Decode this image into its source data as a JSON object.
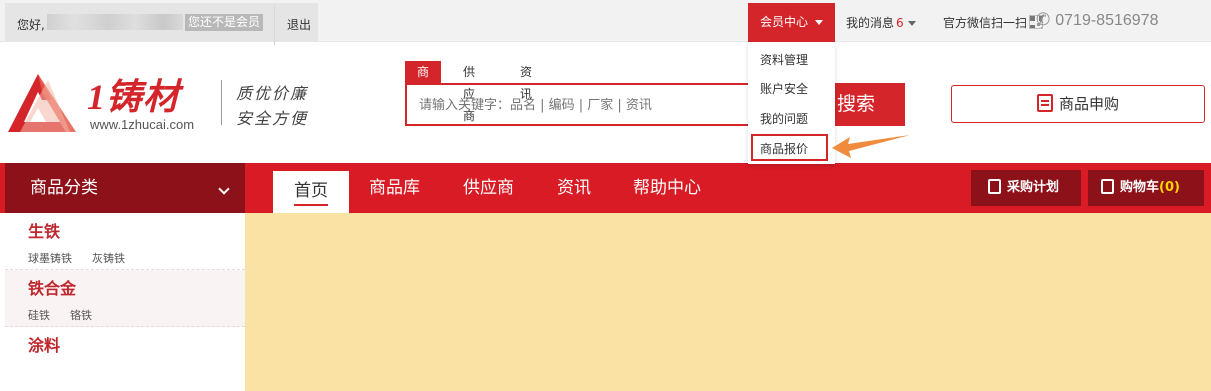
{
  "topbar": {
    "greeting": "您好,",
    "nonmember_label": "您还不是会员",
    "logout_label": "退出",
    "member_center_label": "会员中心",
    "messages_label": "我的消息",
    "messages_count": "6",
    "wechat_label": "官方微信扫一扫",
    "phone": "0719-8516978"
  },
  "member_menu": {
    "items": [
      "资料管理",
      "账户安全",
      "我的问题",
      "商品报价"
    ],
    "highlighted": "商品报价"
  },
  "header": {
    "logo_text": "1铸材",
    "logo_url": "www.1zhucai.com",
    "slogan_line1": "质优价廉",
    "slogan_line2": "安全方便"
  },
  "search": {
    "tabs": [
      "商品",
      "供应商",
      "资讯"
    ],
    "active_tab": "商品",
    "placeholder": "请输入关键字：品名 | 编码 | 厂家 | 资讯",
    "button_label": "搜索"
  },
  "apply_button_label": "商品申购",
  "nav": {
    "category_label": "商品分类",
    "items": [
      "首页",
      "商品库",
      "供应商",
      "资讯",
      "帮助中心"
    ],
    "active_item": "首页",
    "purchase_plan_label": "采购计划",
    "cart_label": "购物车",
    "cart_count": "(0)"
  },
  "categories": [
    {
      "title": "生铁",
      "subs": [
        "球墨铸铁",
        "灰铸铁"
      ]
    },
    {
      "title": "铁合金",
      "subs": [
        "硅铁",
        "铬铁"
      ]
    },
    {
      "title": "涂料",
      "subs": []
    }
  ],
  "colors": {
    "brand_red": "#d4252a",
    "nav_red": "#d91b25",
    "dark_red": "#8d1118",
    "main_bg": "#f9e2a3",
    "arrow_orange": "#f08a3c"
  }
}
